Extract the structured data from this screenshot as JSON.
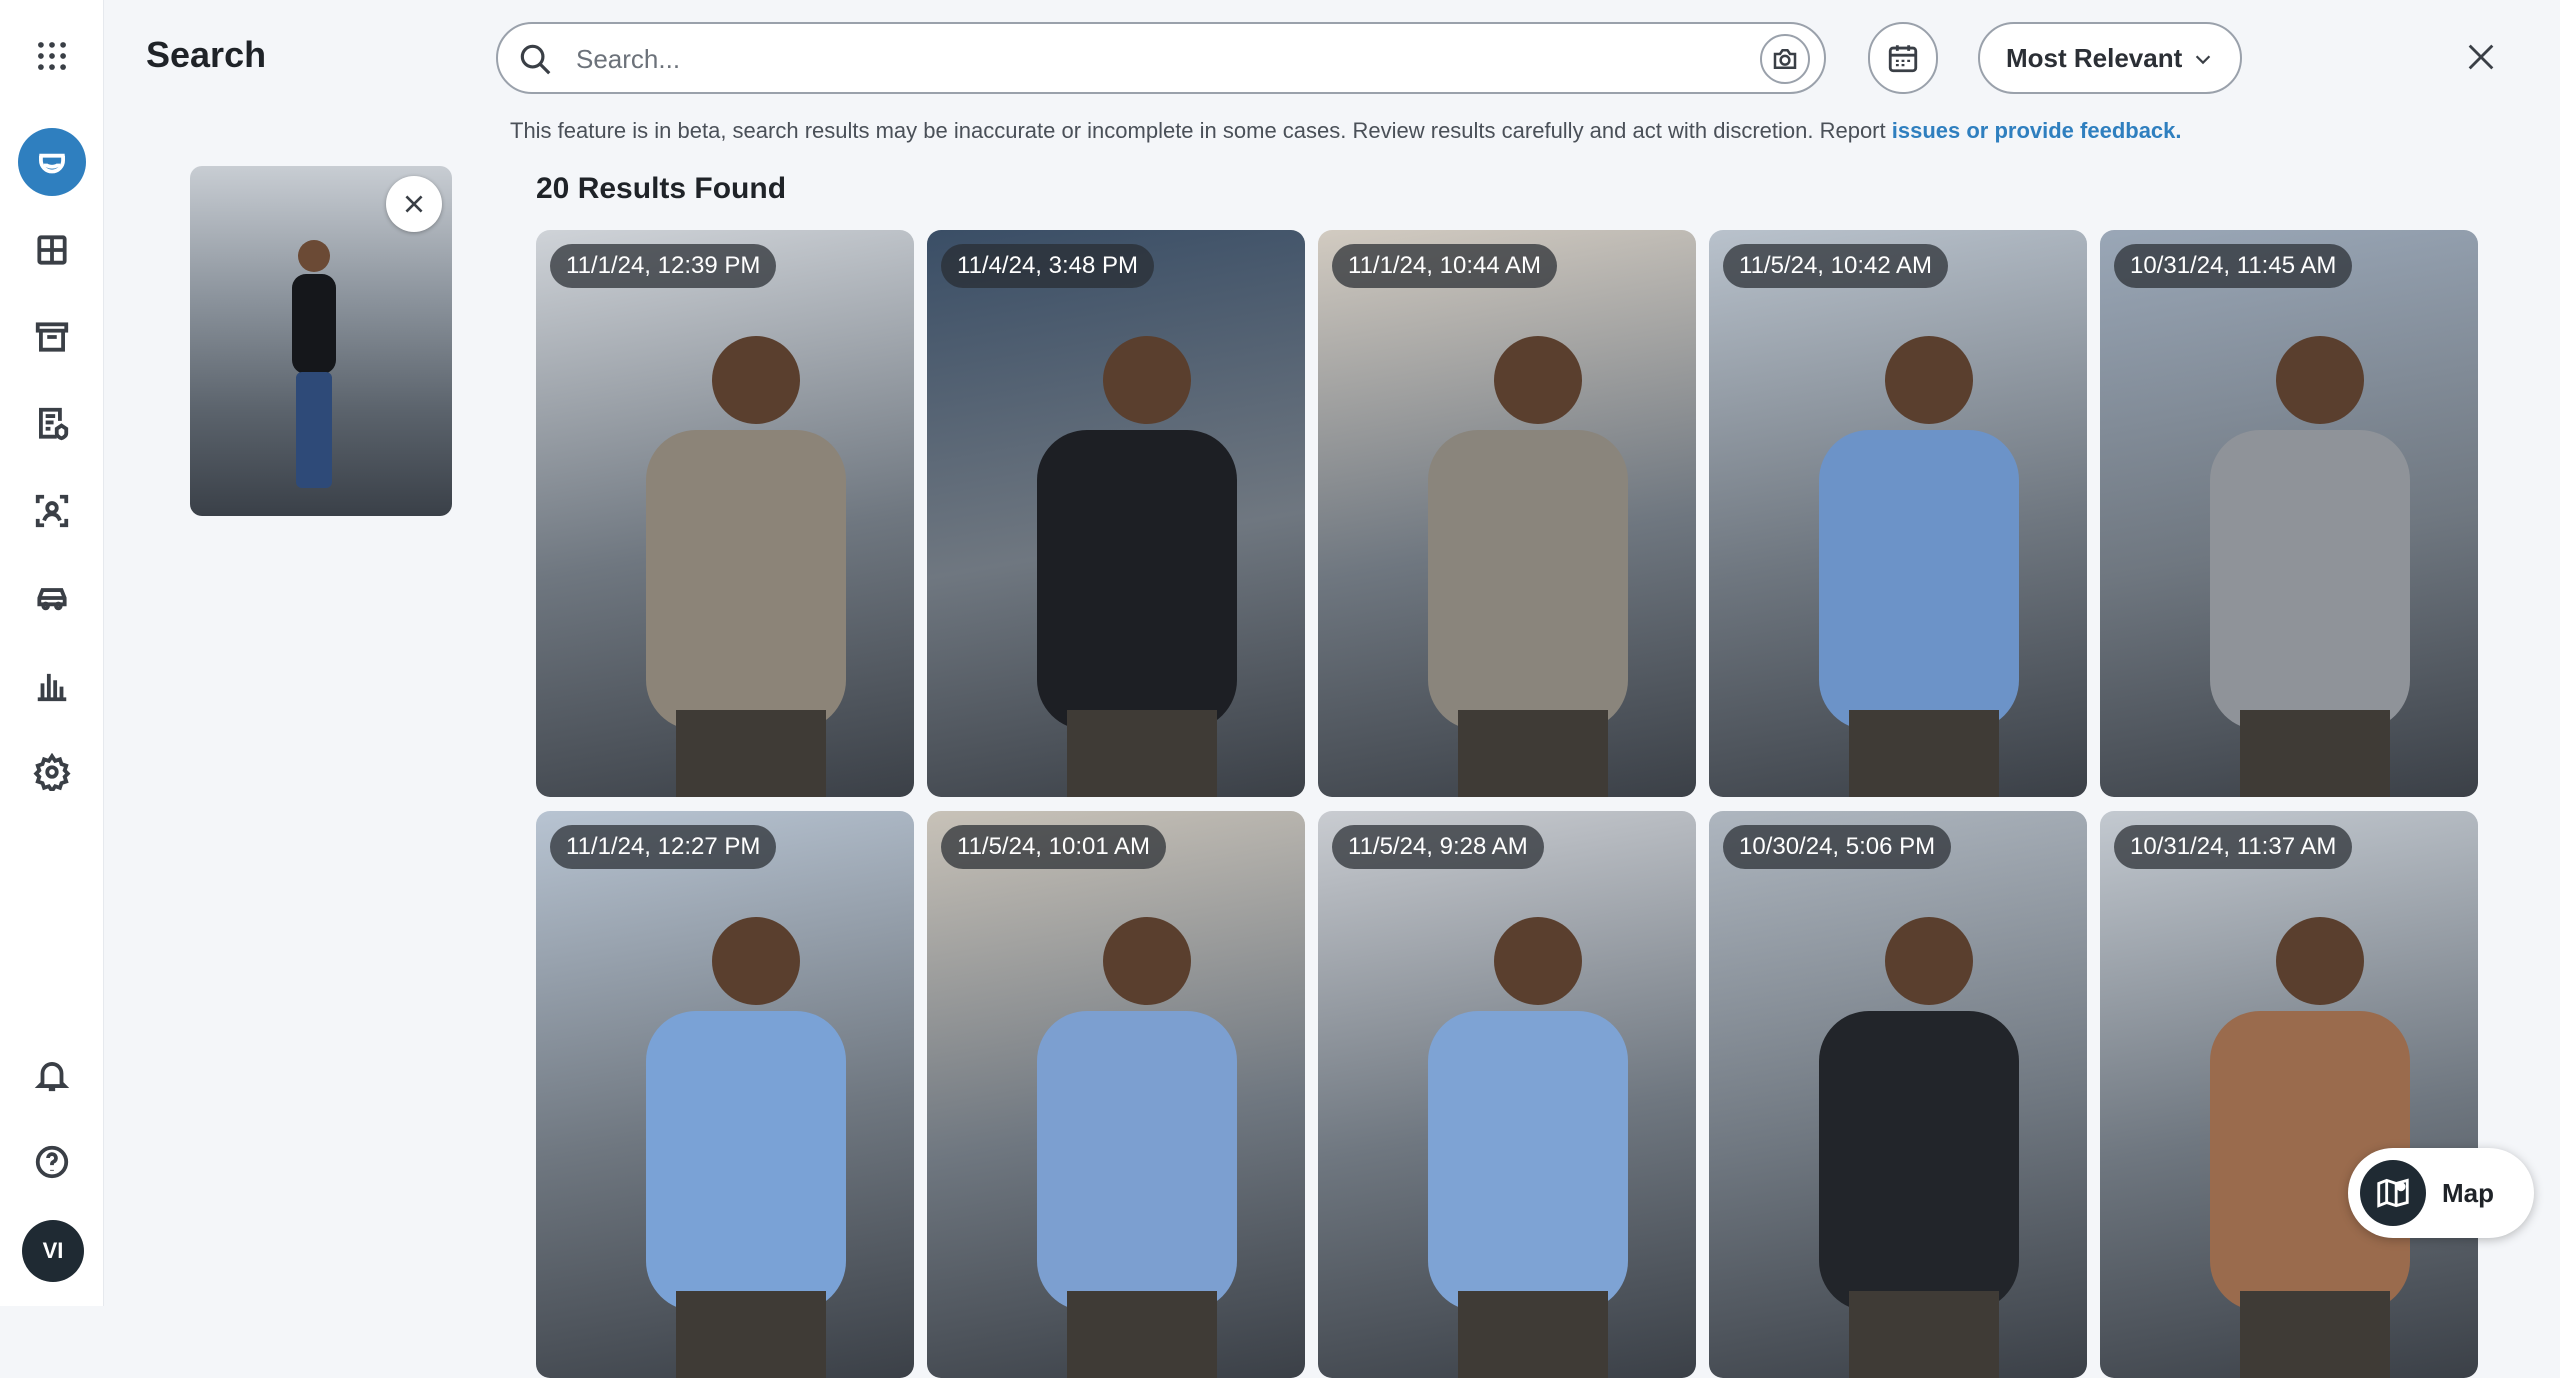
{
  "page": {
    "title": "Search"
  },
  "search": {
    "placeholder": "Search...",
    "value": ""
  },
  "sort": {
    "selected": "Most Relevant"
  },
  "beta_notice": {
    "text": "This feature is in beta, search results may be inaccurate or incomplete in some cases. Review results carefully and act with discretion. Report ",
    "link_text": "issues or provide feedback."
  },
  "results": {
    "count_label": "20 Results Found",
    "items": [
      {
        "timestamp": "11/1/24, 12:39 PM",
        "shirt": "#8c8478",
        "bg": "#cfd3d8"
      },
      {
        "timestamp": "11/4/24, 3:48 PM",
        "shirt": "#1d1f24",
        "bg": "#3a4e66"
      },
      {
        "timestamp": "11/1/24, 10:44 AM",
        "shirt": "#8a857c",
        "bg": "#d2cbc1"
      },
      {
        "timestamp": "11/5/24, 10:42 AM",
        "shirt": "#6c93c8",
        "bg": "#b9c2cc"
      },
      {
        "timestamp": "10/31/24, 11:45 AM",
        "shirt": "#8f9399",
        "bg": "#9aa7b7"
      },
      {
        "timestamp": "11/1/24, 12:27 PM",
        "shirt": "#7aa2d6",
        "bg": "#b8c4d2"
      },
      {
        "timestamp": "11/5/24, 10:01 AM",
        "shirt": "#7c9fd0",
        "bg": "#c8c2b8"
      },
      {
        "timestamp": "11/5/24, 9:28 AM",
        "shirt": "#7ea3d4",
        "bg": "#c9ccd1"
      },
      {
        "timestamp": "10/30/24, 5:06 PM",
        "shirt": "#22252a",
        "bg": "#aeb6bf"
      },
      {
        "timestamp": "10/31/24, 11:37 AM",
        "shirt": "#9a6b4d",
        "bg": "#c3c9d0"
      }
    ]
  },
  "map_button": {
    "label": "Map"
  },
  "user": {
    "initials": "VI"
  },
  "colors": {
    "accent": "#2f7fbf",
    "rail_bg": "#ffffff",
    "page_bg": "#f4f6f9"
  }
}
